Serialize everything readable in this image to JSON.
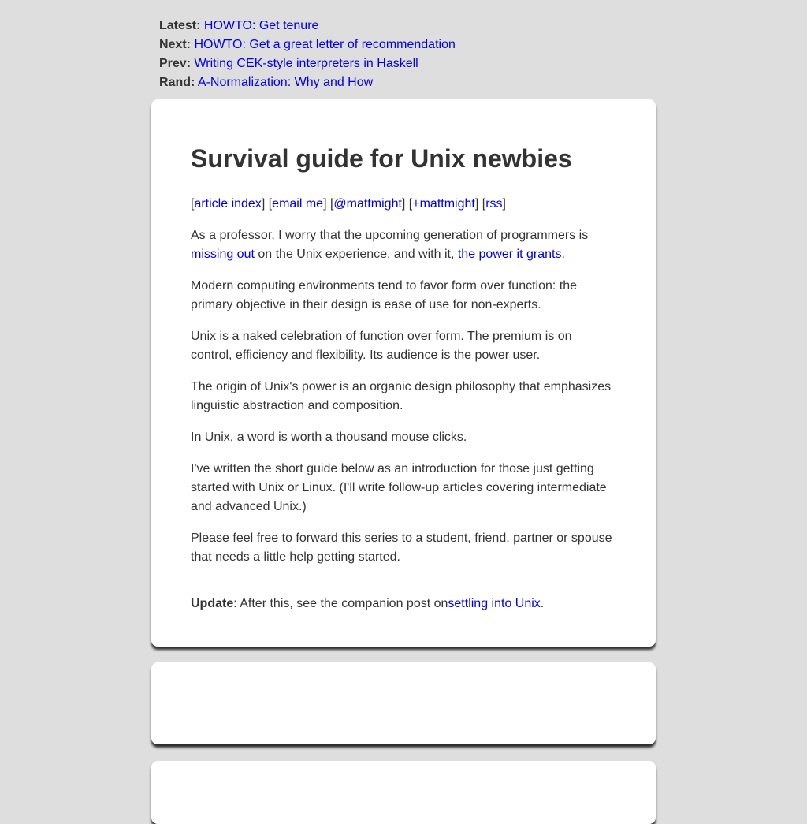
{
  "nav": {
    "latest": {
      "label": "Latest:",
      "link": "HOWTO: Get tenure"
    },
    "next": {
      "label": "Next:",
      "link": "HOWTO: Get a great letter of recommendation"
    },
    "prev": {
      "label": "Prev:",
      "link": "Writing CEK-style interpreters in Haskell"
    },
    "rand": {
      "label": "Rand:",
      "link": "A-Normalization: Why and How"
    }
  },
  "article": {
    "title": "Survival guide for Unix newbies",
    "links": {
      "article_index": "article index",
      "email_me": "email me",
      "twitter": "@mattmight",
      "gplus": "+mattmight",
      "rss": "rss"
    },
    "p1": {
      "before": "As a professor, I worry that the upcoming generation of programmers is ",
      "link1": "missing out",
      "middle": " on the Unix experience, and with it, ",
      "link2": "the power it grants",
      "after": "."
    },
    "p2": "Modern computing environments tend to favor form over function: the primary objective in their design is ease of use for non-experts.",
    "p3": "Unix is a naked celebration of function over form. The premium is on control, efficiency and flexibility. Its audience is the power user.",
    "p4": "The origin of Unix's power is an organic design philosophy that emphasizes linguistic abstraction and composition.",
    "p5": "In Unix, a word is worth a thousand mouse clicks.",
    "p6": "I've written the short guide below as an introduction for those just getting started with Unix or Linux. (I'll write follow-up articles covering intermediate and advanced Unix.)",
    "p7": "Please feel free to forward this series to a student, friend, partner or spouse that needs a little help getting started.",
    "update": {
      "label": "Update",
      "text": ": After this, see the companion post on",
      "link": "settling into Unix",
      "after": "."
    }
  },
  "colors": {
    "background": "#dedede",
    "card": "#ffffff",
    "link": "#0000ee",
    "text": "#333333"
  }
}
